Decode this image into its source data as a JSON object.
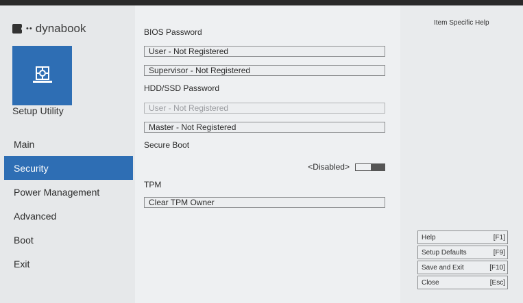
{
  "brand": {
    "name": "dynabook",
    "dots": "• •"
  },
  "sidebar": {
    "title": "Setup Utility",
    "items": [
      {
        "label": "Main",
        "active": false
      },
      {
        "label": "Security",
        "active": true
      },
      {
        "label": "Power Management",
        "active": false
      },
      {
        "label": "Advanced",
        "active": false
      },
      {
        "label": "Boot",
        "active": false
      },
      {
        "label": "Exit",
        "active": false
      }
    ]
  },
  "main": {
    "bios_password_label": "BIOS Password",
    "bios_user": "User - Not Registered",
    "bios_supervisor": "Supervisor - Not Registered",
    "hdd_password_label": "HDD/SSD Password",
    "hdd_user": "User - Not Registered",
    "hdd_master": "Master - Not Registered",
    "secure_boot_label": "Secure Boot",
    "secure_boot_value": "<Disabled>",
    "tpm_label": "TPM",
    "tpm_clear": "Clear TPM Owner"
  },
  "help": {
    "title": "Item Specific Help",
    "keys": [
      {
        "label": "Help",
        "key": "[F1]"
      },
      {
        "label": "Setup Defaults",
        "key": "[F9]"
      },
      {
        "label": "Save and Exit",
        "key": "[F10]"
      },
      {
        "label": "Close",
        "key": "[Esc]"
      }
    ]
  },
  "colors": {
    "accent": "#2e6eb4"
  },
  "icons": {
    "app_tile": "gear-laptop-icon",
    "toggle": "toggle-switch"
  }
}
